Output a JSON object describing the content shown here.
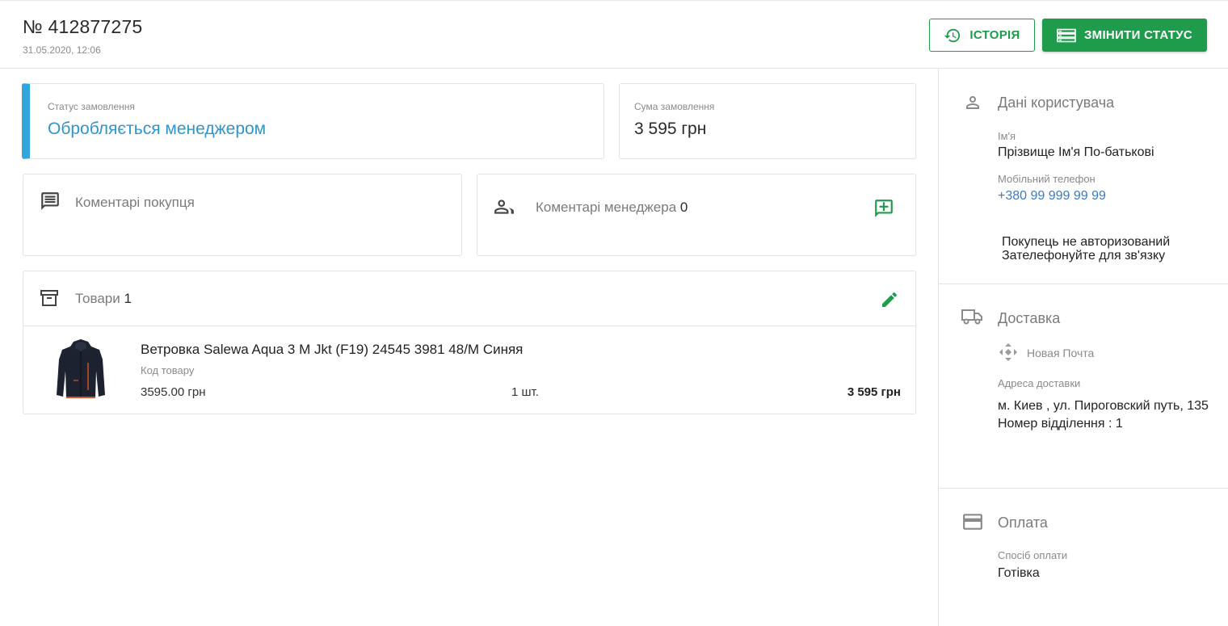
{
  "header": {
    "order_number": "№ 412877275",
    "order_date": "31.05.2020, 12:06",
    "history_label": "ІСТОРІЯ",
    "change_status_label": "ЗМІНИТИ СТАТУС"
  },
  "status": {
    "label": "Статус замовлення",
    "value": "Обробляється менеджером",
    "accent_color": "#2fa6dc"
  },
  "sum": {
    "label": "Сума замовлення",
    "value": "3 595 грн"
  },
  "buyer_comments": {
    "title": "Коментарі покупця",
    "icon": "comment-icon"
  },
  "manager_comments": {
    "title": "Коментарі менеджера",
    "count": "0",
    "icon": "people-icon",
    "add_icon": "add-comment-icon"
  },
  "goods": {
    "title": "Товари",
    "count": "1",
    "icon": "archive-icon",
    "edit_icon": "pencil-icon",
    "items": [
      {
        "name": "Ветровка Salewa Aqua 3 M Jkt (F19) 24545 3981 48/M Синяя",
        "code_label": "Код товару",
        "price": "3595.00 грн",
        "qty": "1 шт.",
        "total": "3 595 грн"
      }
    ]
  },
  "user": {
    "title": "Дані користувача",
    "icon": "person-icon",
    "name_label": "Ім'я",
    "name": "Прізвище Ім'я По-батькові",
    "phone_label": "Мобільний телефон",
    "phone": "+380 99 999 99 99",
    "note_line1": "Покупець не авторизований",
    "note_line2": "Зателефонуйте для зв'язку"
  },
  "delivery": {
    "title": "Доставка",
    "icon": "truck-icon",
    "carrier": "Новая Почта",
    "address_label": "Адреса доставки",
    "address": "м. Киев , ул. Пироговский путь, 135",
    "branch": "Номер відділення : 1"
  },
  "payment": {
    "title": "Оплата",
    "icon": "credit-card-icon",
    "method_label": "Спосіб оплати",
    "method": "Готівка"
  },
  "colors": {
    "primary_green": "#1e9b4b",
    "status_blue": "#2f95cc",
    "phone_blue": "#3d7bbf"
  }
}
